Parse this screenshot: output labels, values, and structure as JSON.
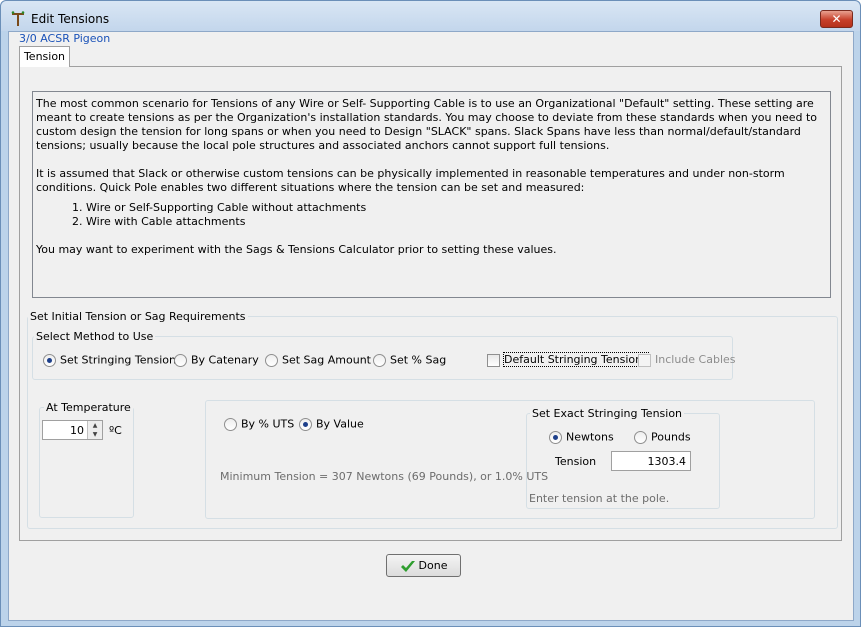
{
  "window": {
    "title": "Edit Tensions",
    "close_glyph": "✕",
    "subtitle": "3/0 ACSR Pigeon"
  },
  "tabs": [
    {
      "label": "Tension",
      "selected": true
    }
  ],
  "info": {
    "para1": "The most common scenario for Tensions of any Wire or Self- Supporting Cable is to use an Organizational \"Default\" setting. These setting are meant to create tensions as per the Organization's installation standards. You may choose to deviate from these standards when you need to custom design the tension for long spans or when you need to Design \"SLACK\" spans. Slack Spans have less than normal/default/standard tensions; usually because the local pole structures and associated anchors cannot support full tensions.",
    "para2": "It is assumed that Slack or otherwise custom tensions can be physically implemented in reasonable temperatures and under non-storm conditions. Quick Pole enables two different situations where the tension can be set and measured:",
    "list": [
      "Wire or Self-Supporting Cable without attachments",
      "Wire with Cable attachments"
    ],
    "para3": "You may want to experiment with the Sags & Tensions Calculator prior to setting these values."
  },
  "requirements": {
    "group_label": "Set Initial Tension or Sag Requirements",
    "method_group_label": "Select Method to Use",
    "methods": [
      {
        "label": "Set Stringing Tension",
        "selected": true
      },
      {
        "label": "By Catenary",
        "selected": false
      },
      {
        "label": "Set Sag Amount",
        "selected": false
      },
      {
        "label": "Set % Sag",
        "selected": false
      }
    ],
    "default_stringing": {
      "label": "Default Stringing Tensions",
      "checked": false
    },
    "include_cables": {
      "label": "Include Cables",
      "checked": false,
      "disabled": true
    }
  },
  "temperature": {
    "group_label": "At Temperature",
    "value": "10",
    "unit": "ºC"
  },
  "tension_mode": {
    "options": [
      {
        "label": "By % UTS",
        "selected": false
      },
      {
        "label": "By Value",
        "selected": true
      }
    ],
    "minimum_text": "Minimum Tension = 307 Newtons (69 Pounds), or 1.0% UTS"
  },
  "exact": {
    "group_label": "Set Exact Stringing Tension",
    "units": [
      {
        "label": "Newtons",
        "selected": true
      },
      {
        "label": "Pounds",
        "selected": false
      }
    ],
    "tension_label": "Tension",
    "tension_value": "1303.4",
    "hint": "Enter tension at the pole."
  },
  "buttons": {
    "done": "Done"
  },
  "colors": {
    "accent_link": "#1a52b8",
    "close_red": "#c7402a",
    "check_green": "#2f9e2f"
  }
}
